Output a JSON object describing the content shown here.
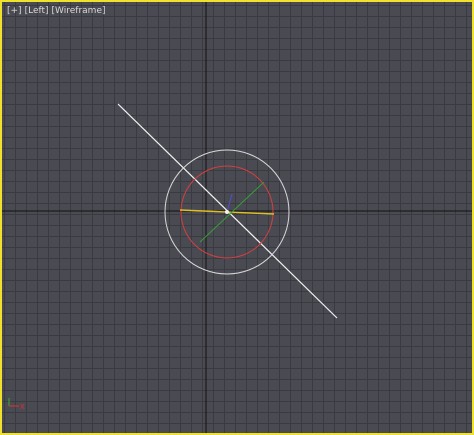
{
  "viewport": {
    "labels": {
      "plus_menu": "[+]",
      "view_menu": "[Left]",
      "shading_menu": "[Wireframe]"
    },
    "active": true,
    "colors": {
      "active_border": "#f0e22a",
      "background": "#4a4a53",
      "grid": "#3a3a41",
      "home_grid_axis": "#111111",
      "light_line": "#f2f2f2",
      "falloff_circle": "#d8d8d8",
      "hotspot_circle": "#d24040",
      "gizmo_x_axis": "#e0c020",
      "gizmo_y_axis": "#35a035",
      "gizmo_z_axis": "#5050d0",
      "axis_tripod_x": "#e03030",
      "axis_tripod_y": "#30b030"
    },
    "axis_tripod": {
      "x_label": "X"
    }
  }
}
